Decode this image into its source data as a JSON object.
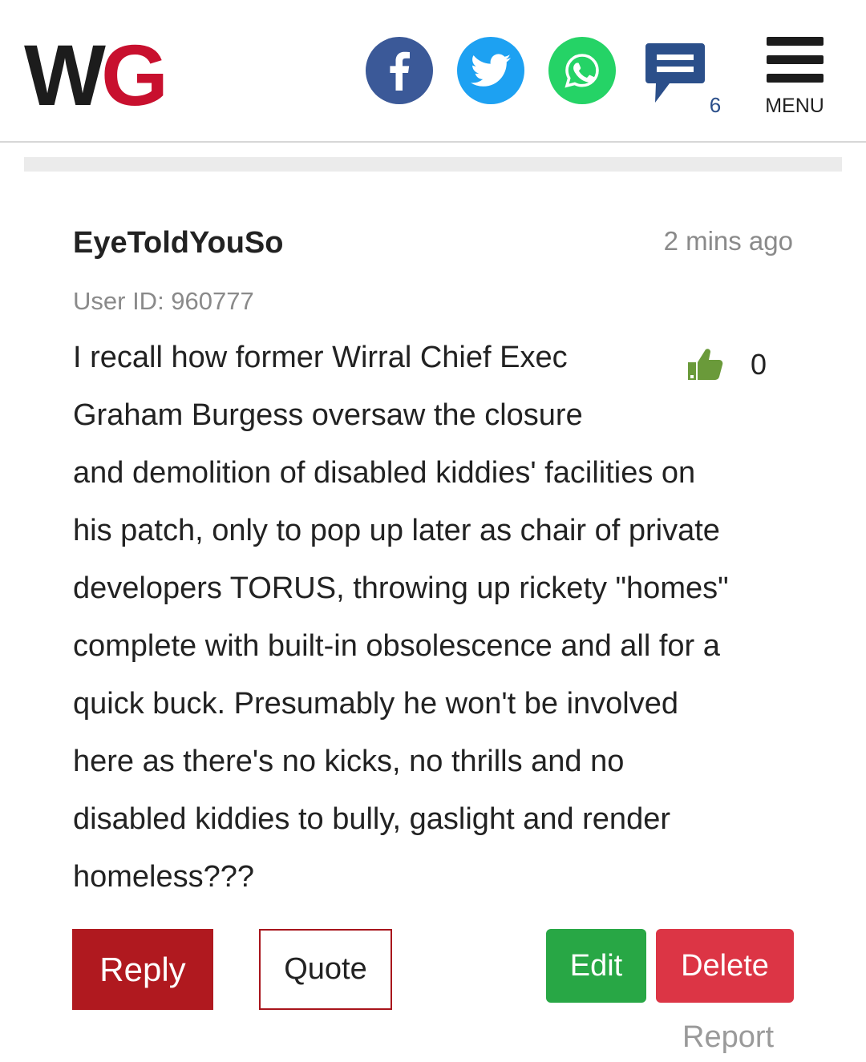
{
  "header": {
    "logo": {
      "part1": "W",
      "part2": "G"
    },
    "share": {
      "facebook_icon": "facebook-icon",
      "twitter_icon": "twitter-icon",
      "whatsapp_icon": "whatsapp-icon"
    },
    "comments": {
      "icon": "comment-bubble-icon",
      "count": "6"
    },
    "menu": {
      "icon": "hamburger-icon",
      "label": "MENU"
    }
  },
  "comment": {
    "username": "EyeToldYouSo",
    "timestamp": "2 mins ago",
    "user_id": "User ID: 960777",
    "likes": {
      "icon": "thumbs-up-icon",
      "count": "0"
    },
    "body_lines": [
      "I recall how former Wirral Chief Exec",
      "Graham Burgess oversaw the closure",
      "and demolition of disabled kiddies' facilities on",
      "his patch, only to pop up later as chair of private",
      "developers TORUS, throwing up rickety \"homes\"",
      "complete with built-in obsolescence and all for a",
      "quick buck. Presumably he won't be involved",
      "here as there's no kicks, no thrills and no",
      "disabled kiddies to bully, gaslight and render",
      "homeless???"
    ]
  },
  "actions": {
    "reply": "Reply",
    "quote": "Quote",
    "edit": "Edit",
    "delete": "Delete",
    "report": "Report"
  },
  "colors": {
    "brand_red": "#c8102e",
    "facebook": "#3b5998",
    "twitter": "#1da1f2",
    "whatsapp": "#25d366",
    "comments_icon": "#2b4f8a",
    "reply_bg": "#b0191f",
    "edit_bg": "#28a745",
    "delete_bg": "#dc3545",
    "like_green": "#6a9a3a"
  }
}
